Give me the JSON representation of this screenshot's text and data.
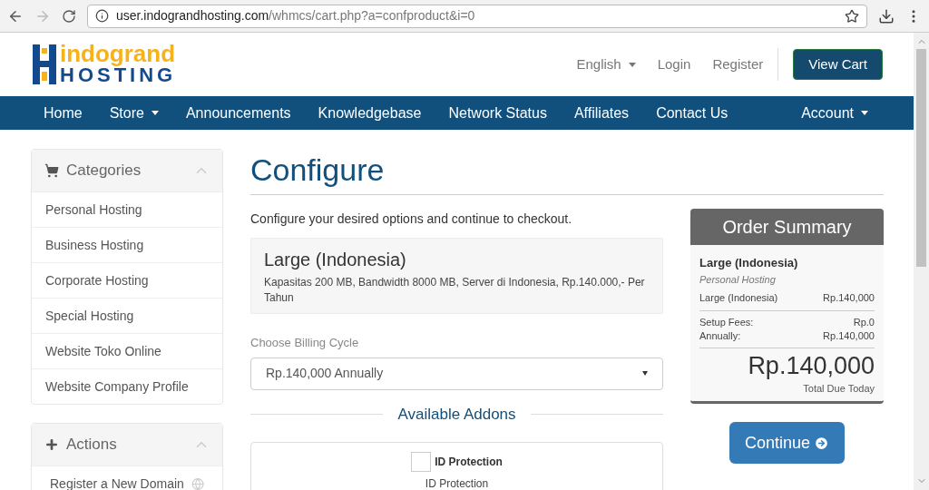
{
  "browser": {
    "url_host": "user.indograndhosting.com",
    "url_path": "/whmcs/cart.php?a=confproduct&i=0"
  },
  "logo": {
    "top": "indogrand",
    "bottom": "HOSTING"
  },
  "header_links": [
    {
      "label": "English",
      "dropdown": true
    },
    {
      "label": "Login",
      "dropdown": false
    },
    {
      "label": "Register",
      "dropdown": false
    }
  ],
  "view_cart": "View Cart",
  "nav": {
    "left": [
      {
        "label": "Home",
        "dropdown": false
      },
      {
        "label": "Store",
        "dropdown": true
      },
      {
        "label": "Announcements",
        "dropdown": false
      },
      {
        "label": "Knowledgebase",
        "dropdown": false
      },
      {
        "label": "Network Status",
        "dropdown": false
      },
      {
        "label": "Affiliates",
        "dropdown": false
      },
      {
        "label": "Contact Us",
        "dropdown": false
      }
    ],
    "right": [
      {
        "label": "Account",
        "dropdown": true
      }
    ]
  },
  "sidebar": [
    {
      "title": "Categories",
      "items": [
        "Personal Hosting",
        "Business Hosting",
        "Corporate Hosting",
        "Special Hosting",
        "Website Toko Online",
        "Website Company Profile"
      ]
    },
    {
      "title": "Actions",
      "items": [
        "Register a New Domain"
      ]
    }
  ],
  "page_title": "Configure",
  "intro": "Configure your desired options and continue to checkout.",
  "product": {
    "name": "Large (Indonesia)",
    "description": "Kapasitas 200 MB, Bandwidth 8000 MB, Server di Indonesia, Rp.140.000,- Per Tahun"
  },
  "billing": {
    "label": "Choose Billing Cycle",
    "value": "Rp.140,000 Annually"
  },
  "addons_heading": "Available Addons",
  "addons": [
    {
      "name": "ID Protection",
      "checked": false,
      "description": "ID Protection"
    }
  ],
  "summary": {
    "title": "Order Summary",
    "product": "Large (Indonesia)",
    "group": "Personal Hosting",
    "lines": [
      {
        "label": "Large (Indonesia)",
        "value": "Rp.140,000"
      }
    ],
    "fees": [
      {
        "label": "Setup Fees:",
        "value": "Rp.0"
      },
      {
        "label": "Annually:",
        "value": "Rp.140,000"
      }
    ],
    "total": "Rp.140,000",
    "total_label": "Total Due Today"
  },
  "continue": "Continue"
}
